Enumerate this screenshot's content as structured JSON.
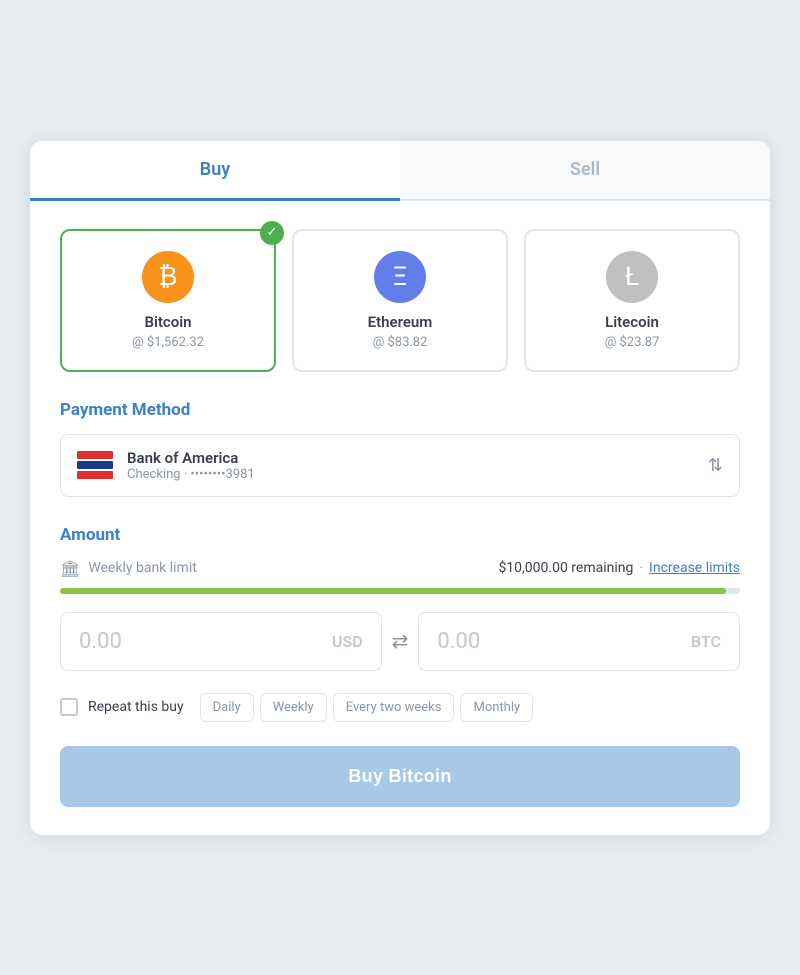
{
  "tabs": [
    {
      "id": "buy",
      "label": "Buy",
      "active": true
    },
    {
      "id": "sell",
      "label": "Sell",
      "active": false
    }
  ],
  "cryptos": [
    {
      "id": "btc",
      "name": "Bitcoin",
      "price": "@ $1,562.32",
      "selected": true,
      "icon_class": "btc",
      "icon_symbol": "₿"
    },
    {
      "id": "eth",
      "name": "Ethereum",
      "price": "@ $83.82",
      "selected": false,
      "icon_class": "eth",
      "icon_symbol": "Ξ"
    },
    {
      "id": "ltc",
      "name": "Litecoin",
      "price": "@ $23.87",
      "selected": false,
      "icon_class": "ltc",
      "icon_symbol": "Ł"
    }
  ],
  "payment_method": {
    "section_label": "Payment Method",
    "bank_name": "Bank of America",
    "bank_detail": "Checking · ••••••••3981"
  },
  "amount": {
    "section_label": "Amount",
    "limit_label": "Weekly bank limit",
    "limit_value": "$10,000.00 remaining",
    "limit_dot": "·",
    "increase_link": "Increase limits",
    "progress_pct": 98,
    "usd_value": "0.00",
    "usd_currency": "USD",
    "btc_value": "0.00",
    "btc_currency": "BTC"
  },
  "repeat": {
    "label": "Repeat this buy",
    "options": [
      "Daily",
      "Weekly",
      "Every two weeks",
      "Monthly"
    ]
  },
  "buy_button": "Buy Bitcoin"
}
